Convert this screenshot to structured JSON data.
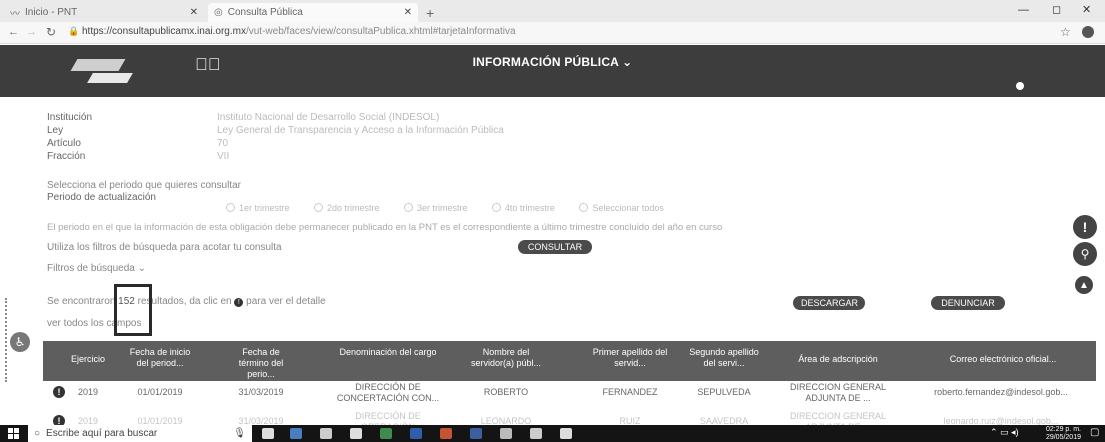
{
  "browser": {
    "tabs": [
      {
        "title": "Inicio - PNT"
      },
      {
        "title": "Consulta Pública"
      }
    ],
    "new_tab": "+",
    "url_host": "https://consultapublicamx.inai.org.mx",
    "url_path": "/vut-web/faces/view/consultaPublica.xhtml#tarjetaInformativa"
  },
  "header": {
    "title": "INFORMACIÓN PÚBLICA ⌄"
  },
  "info": {
    "institucion_label": "Institución",
    "institucion_value": "Instituto Nacional de Desarrollo Social (INDESOL)",
    "ley_label": "Ley",
    "ley_value": "Ley General de Transparencia y Acceso a la Información Pública",
    "articulo_label": "Artículo",
    "articulo_value": "70",
    "fraccion_label": "Fracción",
    "fraccion_value": "VII"
  },
  "period": {
    "prompt": "Selecciona el periodo que quieres consultar",
    "label": "Periodo de actualización",
    "options": [
      "1er trimestre",
      "2do trimestre",
      "3er trimestre",
      "4to trimestre",
      "Seleccionar todos"
    ],
    "note": "El periodo en el que la información de esta obligación debe permanecer publicado en la PNT es el correspondiente a último trimestre concluido del año en curso"
  },
  "search": {
    "hint": "Utiliza los filtros de búsqueda para acotar tu consulta",
    "consultar": "CONSULTAR",
    "filters": "Filtros de búsqueda ⌄"
  },
  "results": {
    "prefix": "Se encontraron",
    "count": "152",
    "suffix": "resultados, da clic en",
    "suffix2": "para ver el detalle",
    "ver_todos": "ver todos los campos",
    "descargar": "DESCARGAR",
    "denunciar": "DENUNCIAR"
  },
  "table": {
    "headers": [
      "Ejercicio",
      "Fecha de inicio del period...",
      "Fecha de término del perio...",
      "Denominación del cargo",
      "Nombre del servidor(a) públ...",
      "Primer apellido del servid...",
      "Segundo apellido del servi...",
      "Área de adscripción",
      "Correo electrónico oficial..."
    ],
    "rows": [
      [
        "2019",
        "01/01/2019",
        "31/03/2019",
        "DIRECCIÓN DE CONCERTACIÓN CON...",
        "ROBERTO",
        "FERNANDEZ",
        "SEPULVEDA",
        "DIRECCION GENERAL ADJUNTA DE ...",
        "roberto.fernandez@indesol.gob..."
      ],
      [
        "2019",
        "01/01/2019",
        "31/03/2019",
        "DIRECCIÓN DE OPERACIÓN",
        "LEONARDO",
        "RUIZ",
        "SAAVEDRA",
        "DIRECCION GENERAL ADJUNTA DE ...",
        "leonardo.ruiz@indesol.gob..."
      ]
    ]
  },
  "taskbar": {
    "search_placeholder": "Escribe aquí para buscar",
    "time": "02:29 p. m.",
    "date": "29/05/2019"
  }
}
